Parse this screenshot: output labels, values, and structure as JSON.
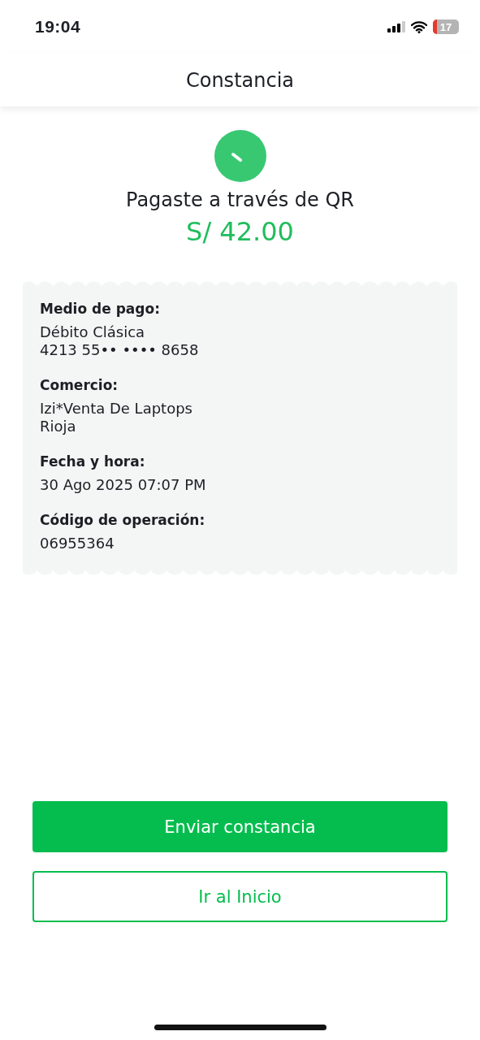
{
  "status_bar": {
    "time": "19:04",
    "battery": "17"
  },
  "header": {
    "title": "Constancia"
  },
  "summary": {
    "title": "Pagaste a través de QR",
    "amount": "S/ 42.00"
  },
  "receipt": [
    {
      "label": "Medio de pago:",
      "lines": [
        "Débito Clásica",
        "4213 55•• •••• 8658"
      ]
    },
    {
      "label": "Comercio:",
      "lines": [
        "Izi*Venta De Laptops",
        "Rioja"
      ]
    },
    {
      "label": "Fecha y hora:",
      "lines": [
        "30 Ago 2025 07:07 PM"
      ]
    },
    {
      "label": "Código de operación:",
      "lines": [
        "06955364"
      ]
    }
  ],
  "buttons": [
    {
      "label": "Enviar constancia",
      "kind": "primary"
    },
    {
      "label": "Ir al Inicio",
      "kind": "secondary"
    }
  ]
}
